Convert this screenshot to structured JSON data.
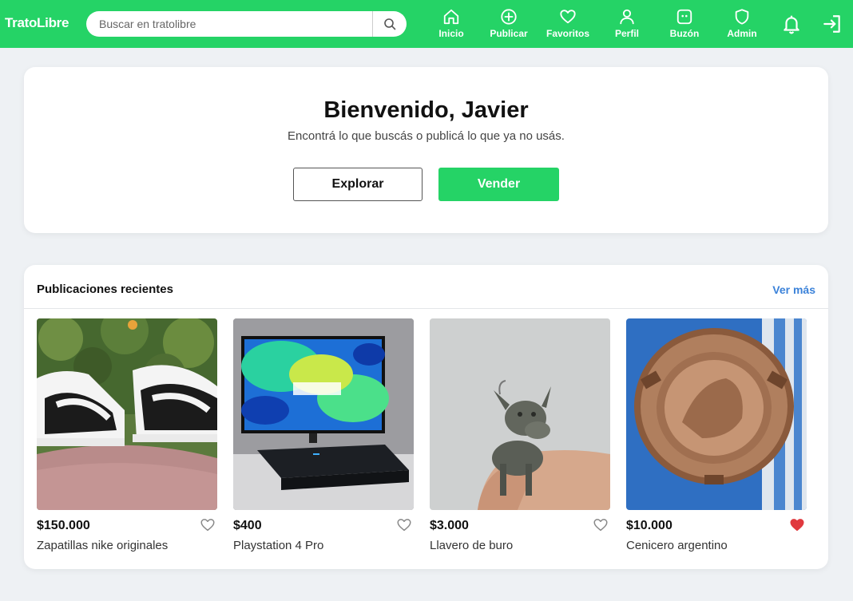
{
  "brand": "TratoLibre",
  "search": {
    "placeholder": "Buscar en tratolibre"
  },
  "nav": {
    "items": [
      {
        "label": "Inicio",
        "icon": "home-icon"
      },
      {
        "label": "Publicar",
        "icon": "plus-circle-icon"
      },
      {
        "label": "Favoritos",
        "icon": "heart-icon"
      },
      {
        "label": "Perfil",
        "icon": "user-icon"
      },
      {
        "label": "Buzón",
        "icon": "inbox-icon"
      },
      {
        "label": "Admin",
        "icon": "shield-icon"
      }
    ],
    "notifications_icon": "bell-icon",
    "logout_icon": "logout-icon"
  },
  "hero": {
    "title": "Bienvenido, Javier",
    "subtitle": "Encontrá lo que buscás o publicá lo que ya no usás.",
    "explore_label": "Explorar",
    "sell_label": "Vender"
  },
  "recent": {
    "title": "Publicaciones recientes",
    "see_more": "Ver más",
    "items": [
      {
        "price": "$150.000",
        "title": "Zapatillas nike originales",
        "favorited": false
      },
      {
        "price": "$400",
        "title": "Playstation 4 Pro",
        "favorited": false
      },
      {
        "price": "$3.000",
        "title": "Llavero de buro",
        "favorited": false
      },
      {
        "price": "$10.000",
        "title": "Cenicero argentino",
        "favorited": true
      }
    ]
  },
  "colors": {
    "brand_green": "#25d366",
    "link_blue": "#3b82d9",
    "favorite_red": "#e0393e",
    "page_bg": "#eef1f4"
  }
}
